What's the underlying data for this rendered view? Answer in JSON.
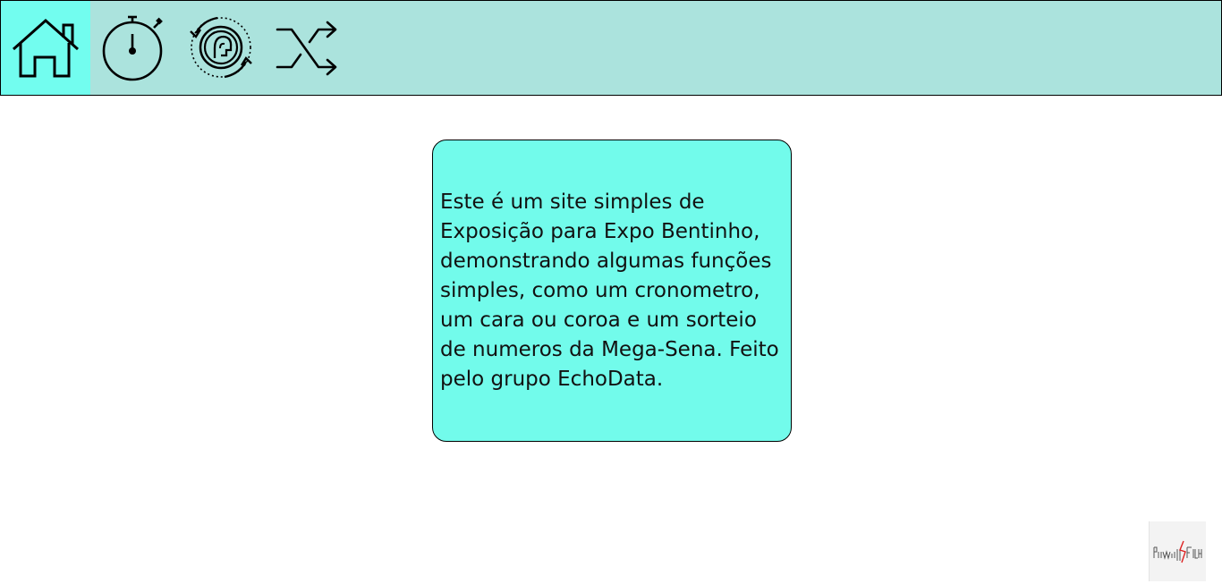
{
  "nav": {
    "items": [
      {
        "id": "home",
        "icon": "home-icon",
        "active": true
      },
      {
        "id": "stopwatch",
        "icon": "stopwatch-icon",
        "active": false
      },
      {
        "id": "coin-flip",
        "icon": "coin-flip-icon",
        "active": false
      },
      {
        "id": "shuffle",
        "icon": "shuffle-icon",
        "active": false
      }
    ]
  },
  "main": {
    "description": "Este é um site simples de Exposição para Expo Bentinho, demonstrando algumas funções simples, como um cronometro, um cara ou coroa e um sorteio de numeros da Mega-Sena. Feito pelo grupo EchoData."
  },
  "badge": {
    "icon": "powered-by-logo"
  },
  "colors": {
    "navbar_bg": "#abe3dd",
    "nav_active_bg": "#72fdef",
    "content_bg": "#72fbeb"
  }
}
